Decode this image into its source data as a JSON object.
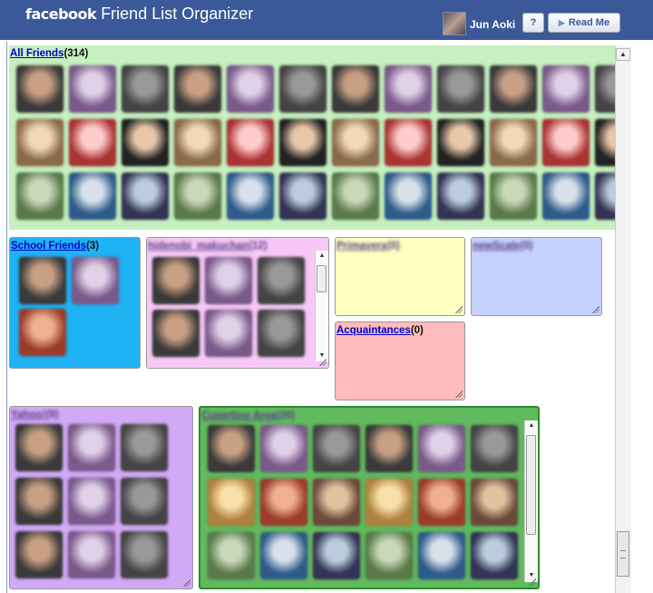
{
  "header": {
    "brand": "facebook",
    "title": "Friend List Organizer",
    "user_name": "Jun Aoki",
    "help_label": "?",
    "readme_label": "Read Me"
  },
  "lists": {
    "all_friends": {
      "name": "All Friends",
      "count": "(314)",
      "bg": "#c6f0c0"
    },
    "school_friends": {
      "name": "School Friends",
      "count": "(3)",
      "bg": "#1fb3f4"
    },
    "hidenobi": {
      "name": "hidenobi_makuchan",
      "count": "(12)",
      "bg": "#f7c8f5"
    },
    "primavera": {
      "name": "Primavera",
      "count": "(0)",
      "bg": "#ffffc0"
    },
    "newscale": {
      "name": "newScale",
      "count": "(0)",
      "bg": "#c5d2fd"
    },
    "acquaintances": {
      "name": "Acquaintances",
      "count": "(0)",
      "bg": "#ffbcbc"
    },
    "yahoo": {
      "name": "Yahoo!",
      "count": "(9)",
      "bg": "#d2a9f7"
    },
    "cupertino": {
      "name": "Cupertino Area",
      "count": "(20)",
      "bg": "#62ba5f"
    }
  }
}
